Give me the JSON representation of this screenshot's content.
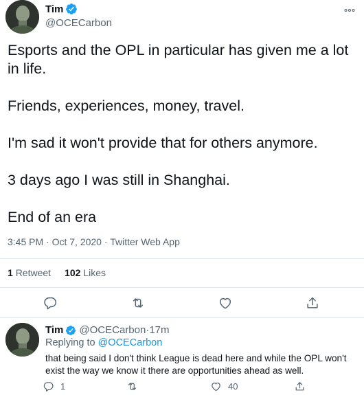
{
  "tweet": {
    "author": {
      "name": "Tim",
      "handle": "@OCECarbon"
    },
    "paragraphs": [
      "Esports and the OPL in particular has given me a lot in life.",
      "Friends, experiences, money, travel.",
      "I'm sad it won't provide that for others anymore.",
      "3 days ago I was still in Shanghai.",
      "End of an era"
    ],
    "time": "3:45 PM",
    "sep1": " · ",
    "date": "Oct 7, 2020",
    "sep2": " · ",
    "source": "Twitter Web App",
    "retweets": {
      "count": "1",
      "label": "Retweet"
    },
    "likes": {
      "count": "102",
      "label": "Likes"
    }
  },
  "reply": {
    "author": {
      "name": "Tim",
      "handle": "@OCECarbon"
    },
    "age_sep": " · ",
    "age": "17m",
    "replying_prefix": "Replying to ",
    "replying_to": "@OCECarbon",
    "text": "that being said I don't think League is dead here and while the OPL won't exist the way we know it there are opportunities ahead as well.",
    "reply_count": "1",
    "retweet_count": "",
    "like_count": "40"
  },
  "icons": {
    "verified": "verified-badge-icon",
    "more": "more-options-icon",
    "reply": "reply-icon",
    "retweet": "retweet-icon",
    "like": "heart-icon",
    "share": "share-icon"
  },
  "colors": {
    "accent": "#1da1f2",
    "mention": "#1b95e0",
    "text": "#0f1419",
    "secondary": "#536471",
    "divider": "#e1e8ed"
  }
}
